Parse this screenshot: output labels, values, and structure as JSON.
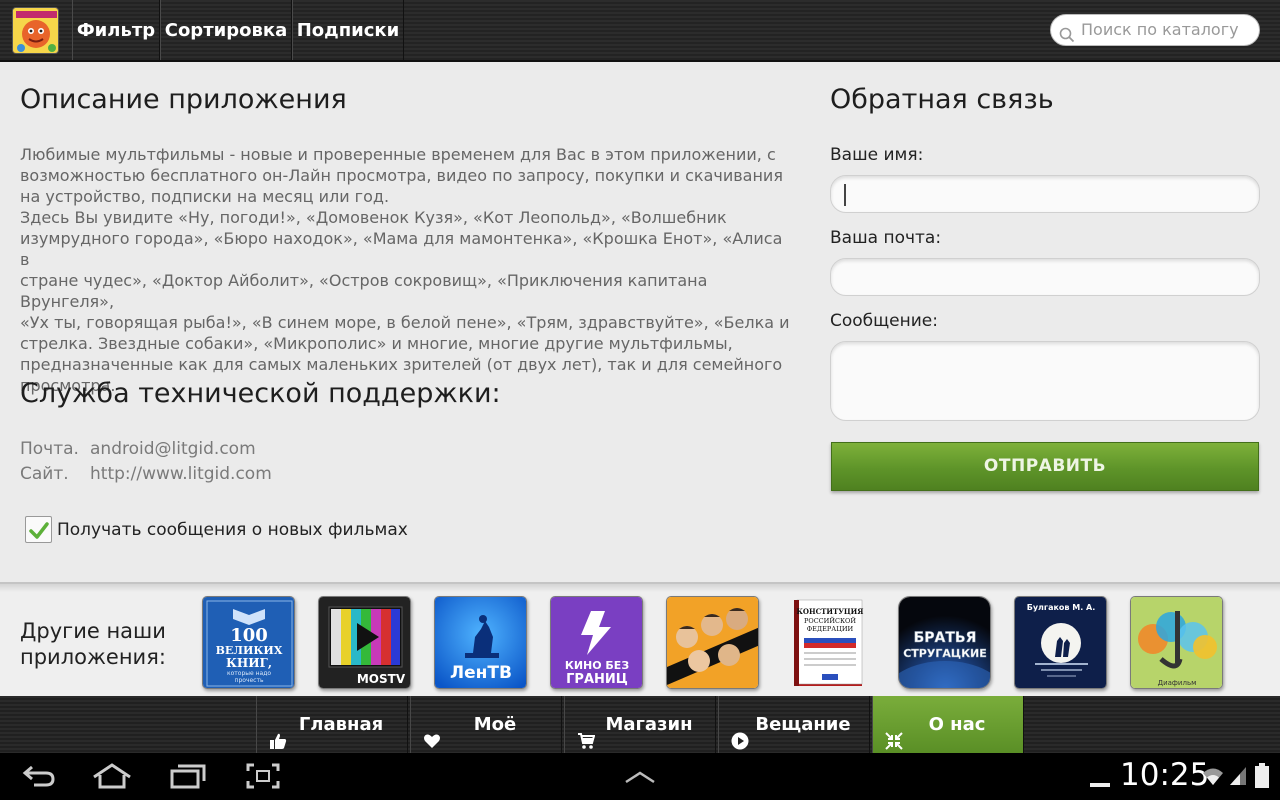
{
  "topbar": {
    "filter_label": "Фильтр",
    "sort_label": "Сортировка",
    "subscriptions_label": "Подписки",
    "search_placeholder": "Поиск по каталогу"
  },
  "description": {
    "title": "Описание приложения",
    "text": "Любимые мультфильмы - новые и проверенные временем для Вас в этом приложении, с\nвозможностью бесплатного он-Лайн просмотра, видео по запросу, покупки и скачивания\nна устройство, подписки на месяц или год.\nЗдесь Вы увидите «Ну, погоди!», «Домовенок Кузя», «Кот Леопольд», «Волшебник\nизумрудного города», «Бюро находок», «Мама для мамонтенка», «Крошка Енот», «Алиса в\nстране чудес», «Доктор Айболит», «Остров сокровищ», «Приключения капитана Врунгеля»,\n«Ух ты, говорящая рыба!», «В синем море, в белой пене», «Трям, здравствуйте», «Белка и\nстрелка. Звездные собаки», «Микрополис» и многие, многие другие мультфильмы,\nпредназначенные как для самых маленьких зрителей (от двух лет), так и для семейного\nпросмотра."
  },
  "support": {
    "title": "Служба технической поддержки:",
    "mail_label": "Почта.",
    "mail_value": "android@litgid.com",
    "site_label": "Сайт.",
    "site_value": "http://www.litgid.com"
  },
  "notify_checkbox": {
    "label": "Получать сообщения о новых фильмах",
    "checked": true
  },
  "feedback": {
    "title": "Обратная связь",
    "name_label": "Ваше имя:",
    "name_value": "",
    "email_label": "Ваша почта:",
    "email_value": "",
    "message_label": "Сообщение:",
    "message_value": "",
    "send_label": "ОТПРАВИТЬ"
  },
  "other_apps": {
    "title": "Другие наши приложения:",
    "items": [
      {
        "icon": "book-100-icon",
        "line1": "100",
        "line2": "ВЕЛИКИХ",
        "line3": "КНИГ,",
        "line4": "которые надо",
        "line5": "прочесть"
      },
      {
        "icon": "mostv-icon",
        "label": "MOSTV"
      },
      {
        "icon": "lentv-icon",
        "label": "ЛенТВ"
      },
      {
        "icon": "kino-bez-granits-icon",
        "line1": "КИНО БЕЗ",
        "line2": "ГРАНИЦ"
      },
      {
        "icon": "comedy-group-icon",
        "label": ""
      },
      {
        "icon": "constitution-icon",
        "line1": "КОНСТИТУЦИЯ",
        "line2": "РОССИЙСКОЙ",
        "line3": "ФЕДЕРАЦИИ"
      },
      {
        "icon": "strugatsky-icon",
        "line1": "БРАТЬЯ",
        "line2": "СТРУГАЦКИЕ"
      },
      {
        "icon": "bulgakov-icon",
        "label": "Булгаков М. А."
      },
      {
        "icon": "diafilm-icon",
        "label": "Диафильм"
      }
    ]
  },
  "bottom_nav": {
    "items": [
      {
        "label": "Главная",
        "icon": "thumbs-up-icon",
        "active": false
      },
      {
        "label": "Моё",
        "icon": "heart-icon",
        "active": false
      },
      {
        "label": "Магазин",
        "icon": "cart-icon",
        "active": false
      },
      {
        "label": "Вещание",
        "icon": "play-icon",
        "active": false
      },
      {
        "label": "О нас",
        "icon": "collapse-icon",
        "active": true
      }
    ]
  },
  "system_bar": {
    "time": "10:25"
  },
  "colors": {
    "accent_green": "#5e9429",
    "topbar_bg": "#2a2a2a",
    "content_bg": "#ebebeb"
  }
}
